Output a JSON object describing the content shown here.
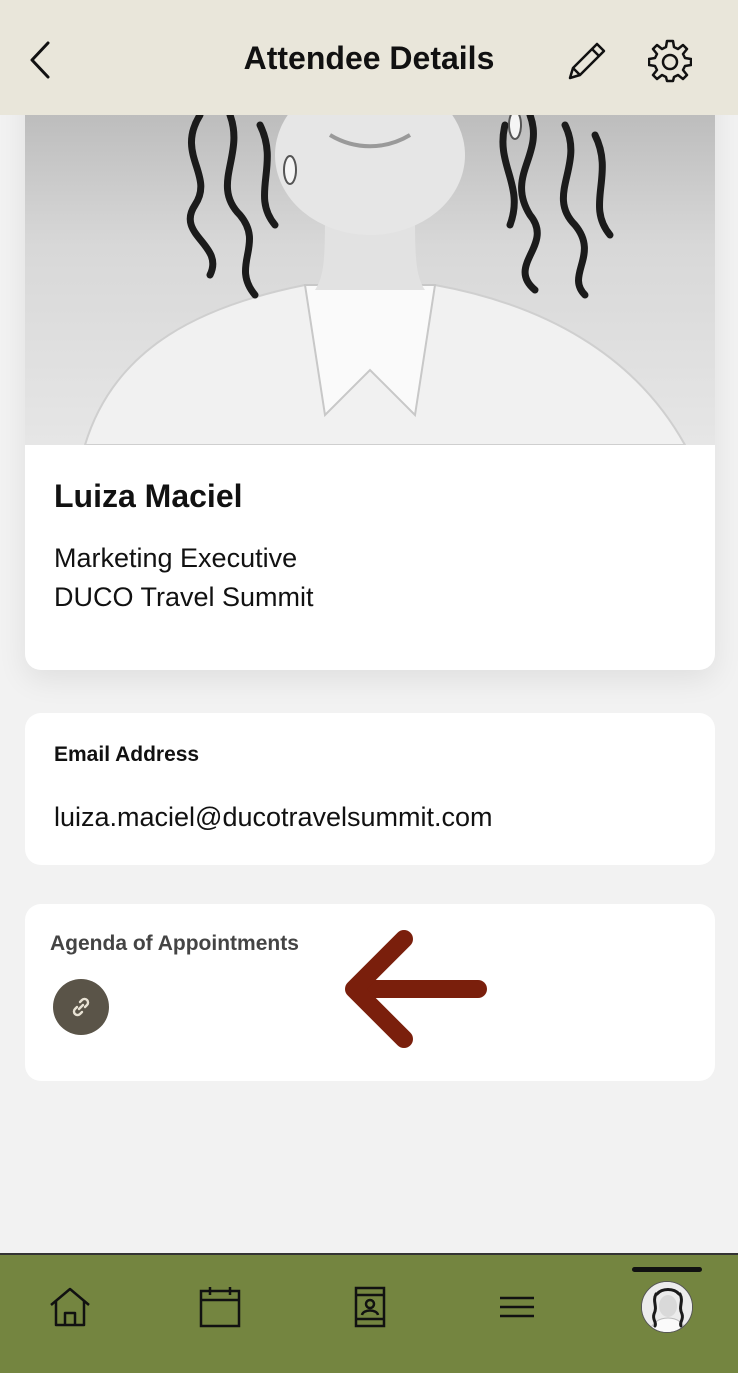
{
  "header": {
    "title": "Attendee Details",
    "back_icon": "chevron-left-icon",
    "edit_icon": "pencil-icon",
    "settings_icon": "gear-icon"
  },
  "profile": {
    "name": "Luiza Maciel",
    "role": "Marketing Executive",
    "organization": "DUCO Travel Summit"
  },
  "email": {
    "label": "Email Address",
    "value": "luiza.maciel@ducotravelsummit.com"
  },
  "agenda": {
    "label": "Agenda of Appointments",
    "link_icon": "link-icon"
  },
  "annotation": {
    "icon": "arrow-left-icon",
    "color": "#7a1f0c"
  },
  "nav": {
    "items": [
      "home-icon",
      "calendar-icon",
      "contact-icon",
      "menu-icon",
      "avatar"
    ],
    "active": "avatar",
    "background": "#748540"
  }
}
